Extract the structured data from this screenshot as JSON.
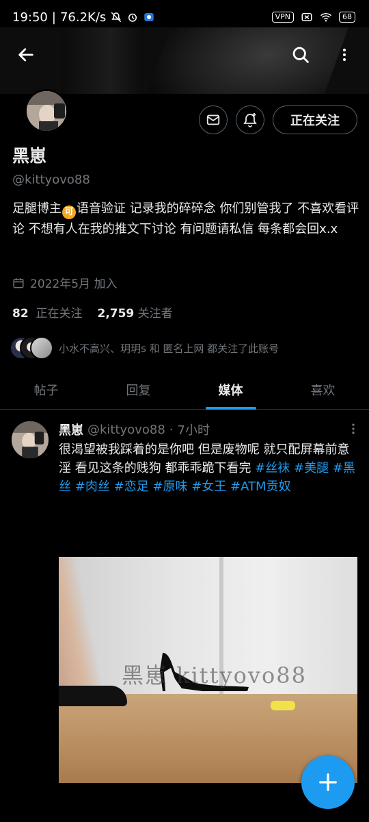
{
  "status_bar": {
    "time": "19:50",
    "network_speed": "76.2K/s",
    "vpn_label": "VPN",
    "battery": "68"
  },
  "profile": {
    "name": "黑崽",
    "handle": "@kittyovo88",
    "bio_before_emoji": "足腿博主",
    "bio_emoji": "可",
    "bio_after_emoji": "语音验证 记录我的碎碎念 你们别管我了 不喜欢看评论 不想有人在我的推文下讨论 有问题请私信 每条都会回x.x",
    "joined": "2022年5月 加入",
    "following_count": "82",
    "following_label": "正在关注",
    "followers_count": "2,759",
    "followers_label": "关注者",
    "followed_by_text": "小水不高兴、玥玥s 和 匿名上网 都关注了此账号",
    "follow_button_label": "正在关注"
  },
  "tabs": [
    {
      "label": "帖子",
      "active": false
    },
    {
      "label": "回复",
      "active": false
    },
    {
      "label": "媒体",
      "active": true
    },
    {
      "label": "喜欢",
      "active": false
    }
  ],
  "tweet": {
    "name": "黑崽",
    "handle": "@kittyovo88",
    "separator": "·",
    "time": "7小时",
    "text_plain": "很渴望被我踩着的是你吧 但是废物呢 就只配屏幕前意淫 看见这条的贱狗 都乖乖跪下看完 ",
    "hashtags": [
      "#丝袜",
      "#美腿",
      "#黑丝",
      "#肉丝",
      "#恋足",
      "#原味",
      "#女王",
      "#ATM贡奴"
    ],
    "media_watermark": "黑崽 kittyovo88"
  },
  "colors": {
    "accent": "#1d9bf0",
    "background": "#000000",
    "text_primary": "#e7e9ea",
    "text_secondary": "#71767b",
    "border": "#2f3336"
  },
  "icons": {
    "back": "arrow-left-icon",
    "search": "search-icon",
    "more": "more-vertical-icon",
    "message": "envelope-icon",
    "notify": "bell-plus-icon",
    "calendar": "calendar-icon",
    "tweet_more": "more-vertical-icon",
    "compose": "plus-icon"
  }
}
